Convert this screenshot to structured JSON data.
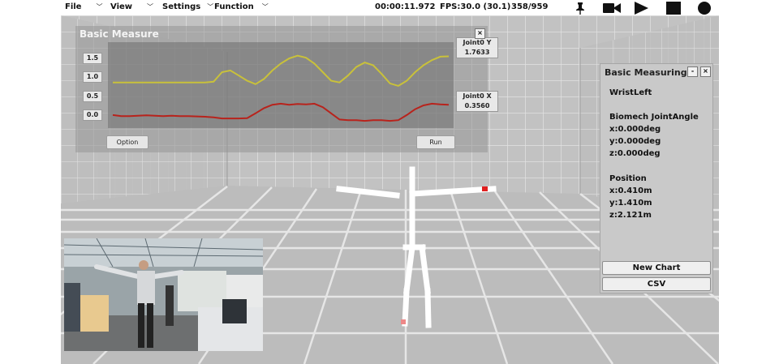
{
  "menu": {
    "file": "File",
    "view": "View",
    "settings": "Settings",
    "function": "Function"
  },
  "status": {
    "time": "00:00:11.972",
    "fps": "FPS:30.0 (30.1)",
    "frame": "358/959"
  },
  "toolbar": {
    "icons": [
      "pin-icon",
      "video-camera-icon",
      "play-icon",
      "stop-icon",
      "record-icon"
    ]
  },
  "basic_measure": {
    "title": "Basic Measure",
    "y_labels": [
      "1.5",
      "1.0",
      "0.5",
      "0.0"
    ],
    "series": [
      {
        "name": "Joint0 Y",
        "value": "1.7633",
        "color": "#c9c13a"
      },
      {
        "name": "Joint0 X",
        "value": "0.3560",
        "color": "#b8231c"
      }
    ],
    "option_label": "Option",
    "run_label": "Run",
    "close": "×"
  },
  "chart_data": {
    "type": "line",
    "ylim": [
      0,
      2
    ],
    "series": [
      {
        "name": "Joint0 Y",
        "values": [
          1.0,
          1.0,
          1.0,
          1.0,
          1.0,
          1.0,
          1.0,
          1.0,
          1.0,
          1.0,
          1.0,
          1.0,
          1.02,
          1.3,
          1.35,
          1.2,
          1.05,
          0.95,
          1.1,
          1.35,
          1.55,
          1.7,
          1.78,
          1.72,
          1.55,
          1.3,
          1.05,
          1.0,
          1.2,
          1.45,
          1.58,
          1.5,
          1.25,
          0.97,
          0.9,
          1.05,
          1.3,
          1.5,
          1.65,
          1.75,
          1.76
        ]
      },
      {
        "name": "Joint0 X",
        "values": [
          0.05,
          0.02,
          0.02,
          0.03,
          0.04,
          0.03,
          0.02,
          0.03,
          0.02,
          0.02,
          0.01,
          0.0,
          -0.02,
          -0.05,
          -0.05,
          -0.05,
          -0.04,
          0.1,
          0.25,
          0.35,
          0.38,
          0.35,
          0.37,
          0.36,
          0.38,
          0.28,
          0.1,
          -0.08,
          -0.1,
          -0.1,
          -0.12,
          -0.1,
          -0.1,
          -0.12,
          -0.1,
          0.05,
          0.22,
          0.33,
          0.38,
          0.36,
          0.35
        ]
      }
    ]
  },
  "measuring": {
    "title": "Basic Measuring",
    "minimize": "-",
    "close": "×",
    "joint": "WristLeft",
    "angle_header": "Biomech JointAngle",
    "angle_x": "x:0.000deg",
    "angle_y": "y:0.000deg",
    "angle_z": "z:0.000deg",
    "position_header": "Position",
    "pos_x": "x:0.410m",
    "pos_y": "y:1.410m",
    "pos_z": "z:2.121m",
    "new_chart": "New Chart",
    "csv": "CSV"
  }
}
